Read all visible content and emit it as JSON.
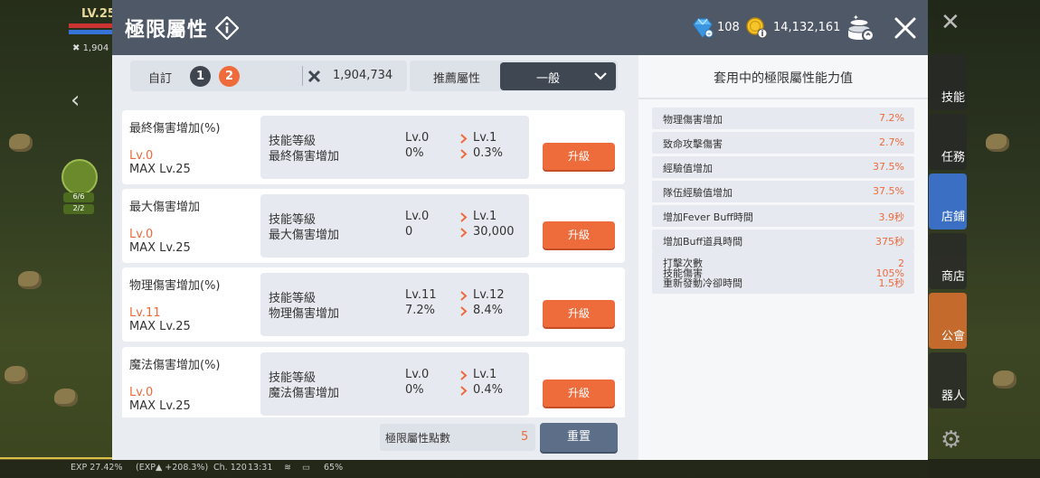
{
  "background": {
    "level": "LV.25",
    "power_short": "1,904",
    "exp": "EXP 27.42%",
    "exp_bonus": "(EXP▲ +208.3%)",
    "channel": "Ch. 120",
    "time": "13:31",
    "battery": "65%",
    "skill_count_1": "6/6",
    "skill_count_2": "2/2",
    "side_buttons": [
      "技能",
      "任務",
      "店鋪",
      "商店",
      "公會",
      "器人"
    ]
  },
  "header": {
    "title": "極限屬性",
    "gems": "108",
    "coins": "14,132,161"
  },
  "toolbar": {
    "preset_label": "自訂",
    "presets": [
      "1",
      "2"
    ],
    "power_value": "1,904,734",
    "recommend_label": "推薦屬性",
    "recommend_selected": "一般"
  },
  "attributes": [
    {
      "name": "最終傷害增加(%)",
      "level": "Lv.0",
      "max": "MAX Lv.25",
      "row1_label": "技能等級",
      "row1_cur": "Lv.0",
      "row1_next": "Lv.1",
      "row2_label": "最終傷害增加",
      "row2_cur": "0%",
      "row2_next": "0.3%",
      "button": "升級"
    },
    {
      "name": "最大傷害增加",
      "level": "Lv.0",
      "max": "MAX Lv.25",
      "row1_label": "技能等級",
      "row1_cur": "Lv.0",
      "row1_next": "Lv.1",
      "row2_label": "最大傷害增加",
      "row2_cur": "0",
      "row2_next": "30,000",
      "button": "升級"
    },
    {
      "name": "物理傷害增加(%)",
      "level": "Lv.11",
      "max": "MAX Lv.25",
      "row1_label": "技能等級",
      "row1_cur": "Lv.11",
      "row1_next": "Lv.12",
      "row2_label": "物理傷害增加",
      "row2_cur": "7.2%",
      "row2_next": "8.4%",
      "button": "升級"
    },
    {
      "name": "魔法傷害增加(%)",
      "level": "Lv.0",
      "max": "MAX Lv.25",
      "row1_label": "技能等級",
      "row1_cur": "Lv.0",
      "row1_next": "Lv.1",
      "row2_label": "魔法傷害增加",
      "row2_cur": "0%",
      "row2_next": "0.4%",
      "button": "升級"
    }
  ],
  "footer": {
    "points_label": "極限屬性點數",
    "points_value": "5",
    "reset_label": "重置"
  },
  "summary": {
    "title": "套用中的極限屬性能力值",
    "rows": [
      {
        "label": "物理傷害增加",
        "value": "7.2%"
      },
      {
        "label": "致命攻擊傷害",
        "value": "2.7%"
      },
      {
        "label": "經驗值增加",
        "value": "37.5%"
      },
      {
        "label": "隊伍經驗值增加",
        "value": "37.5%"
      },
      {
        "label": "增加Fever Buff時間",
        "value": "3.9秒"
      },
      {
        "label": "增加Buff道具時間",
        "value": "375秒"
      }
    ],
    "multi": [
      {
        "label": "打擊次數",
        "value": "2"
      },
      {
        "label": "技能傷害",
        "value": "105%"
      },
      {
        "label": "重新發動冷卻時間",
        "value": "1.5秒"
      }
    ]
  },
  "colors": {
    "accent": "#ee6b3c",
    "header_bg": "#4e5866",
    "reset_button": "#5d6f88"
  },
  "exp_progress_percent": 27.42
}
